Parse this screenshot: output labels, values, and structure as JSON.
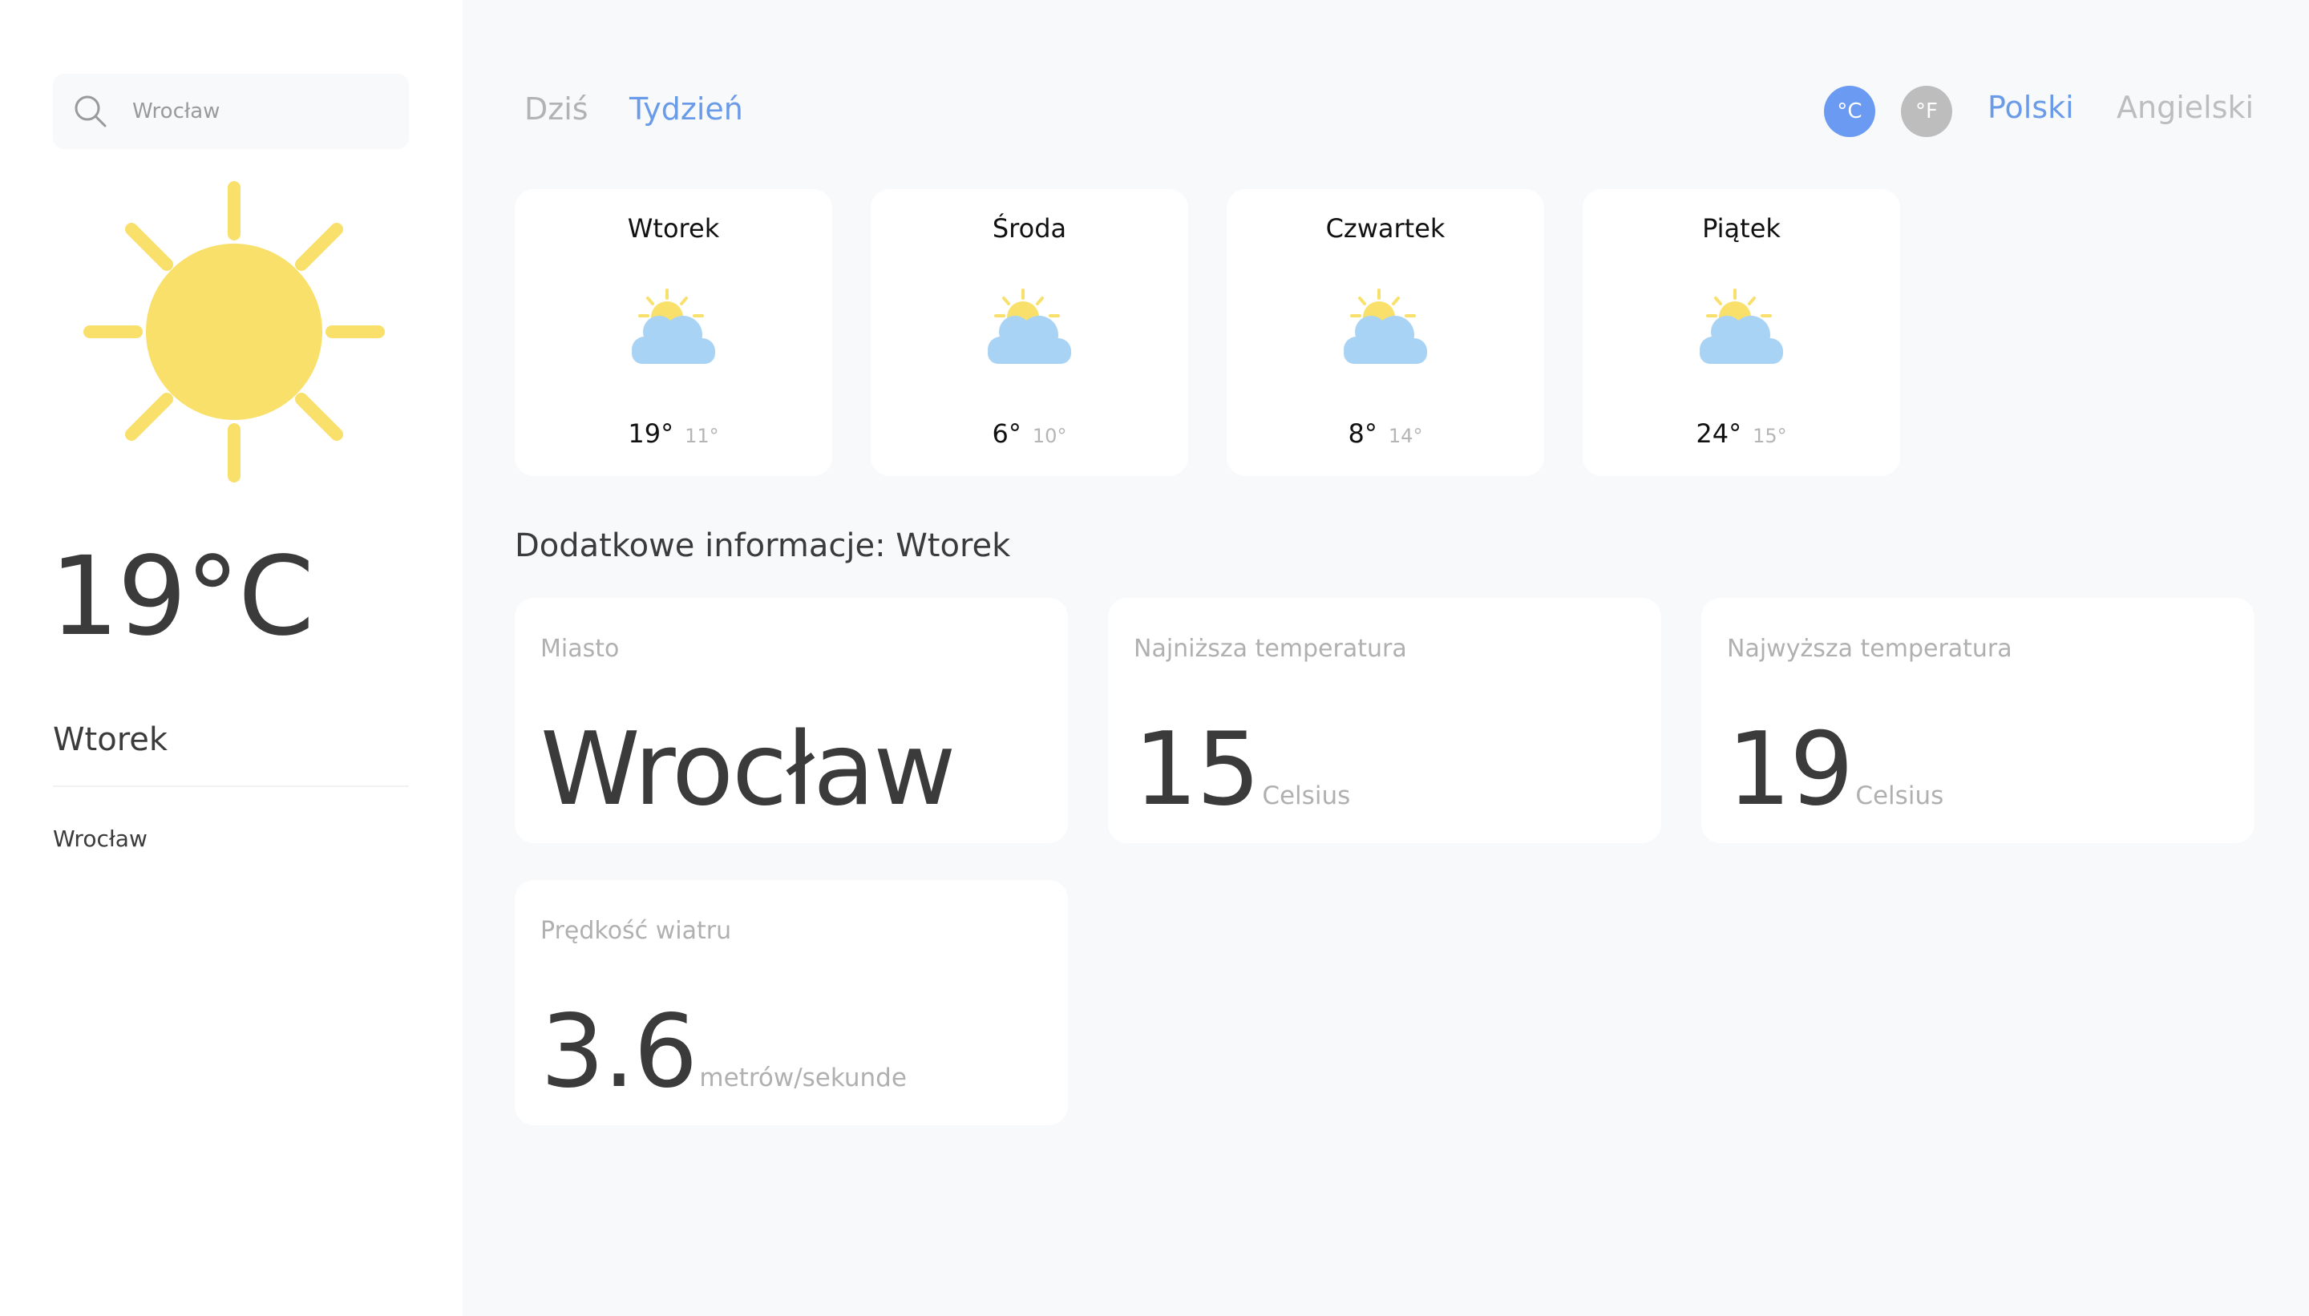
{
  "search": {
    "value": "Wrocław"
  },
  "current": {
    "icon": "sun-icon",
    "temperature": "19°C",
    "day": "Wtorek",
    "city": "Wrocław"
  },
  "nav": {
    "tabs": [
      {
        "label": "Dziś",
        "active": false
      },
      {
        "label": "Tydzień",
        "active": true
      }
    ],
    "units": [
      {
        "label": "°C",
        "active": true
      },
      {
        "label": "°F",
        "active": false
      }
    ],
    "languages": [
      {
        "label": "Polski",
        "active": true
      },
      {
        "label": "Angielski",
        "active": false
      }
    ]
  },
  "forecast": [
    {
      "day": "Wtorek",
      "max": "19°",
      "min": "11°",
      "icon": "partly-cloudy-icon"
    },
    {
      "day": "Środa",
      "max": "6°",
      "min": "10°",
      "icon": "partly-cloudy-icon"
    },
    {
      "day": "Czwartek",
      "max": "8°",
      "min": "14°",
      "icon": "partly-cloudy-icon"
    },
    {
      "day": "Piątek",
      "max": "24°",
      "min": "15°",
      "icon": "partly-cloudy-icon"
    }
  ],
  "details": {
    "title": "Dodatkowe informacje: Wtorek",
    "city": {
      "label": "Miasto",
      "value": "Wrocław"
    },
    "min_temp": {
      "label": "Najniższa temperatura",
      "value": "15",
      "unit": "Celsius"
    },
    "max_temp": {
      "label": "Najwyższa temperatura",
      "value": "19",
      "unit": "Celsius"
    },
    "wind": {
      "label": "Prędkość wiatru",
      "value": "3.6",
      "unit": "metrów/sekunde"
    }
  },
  "colors": {
    "accent": "#6a9af2",
    "sun": "#f9e06b",
    "cloud": "#a9d3f5",
    "inactive": "#bdbdbd"
  }
}
